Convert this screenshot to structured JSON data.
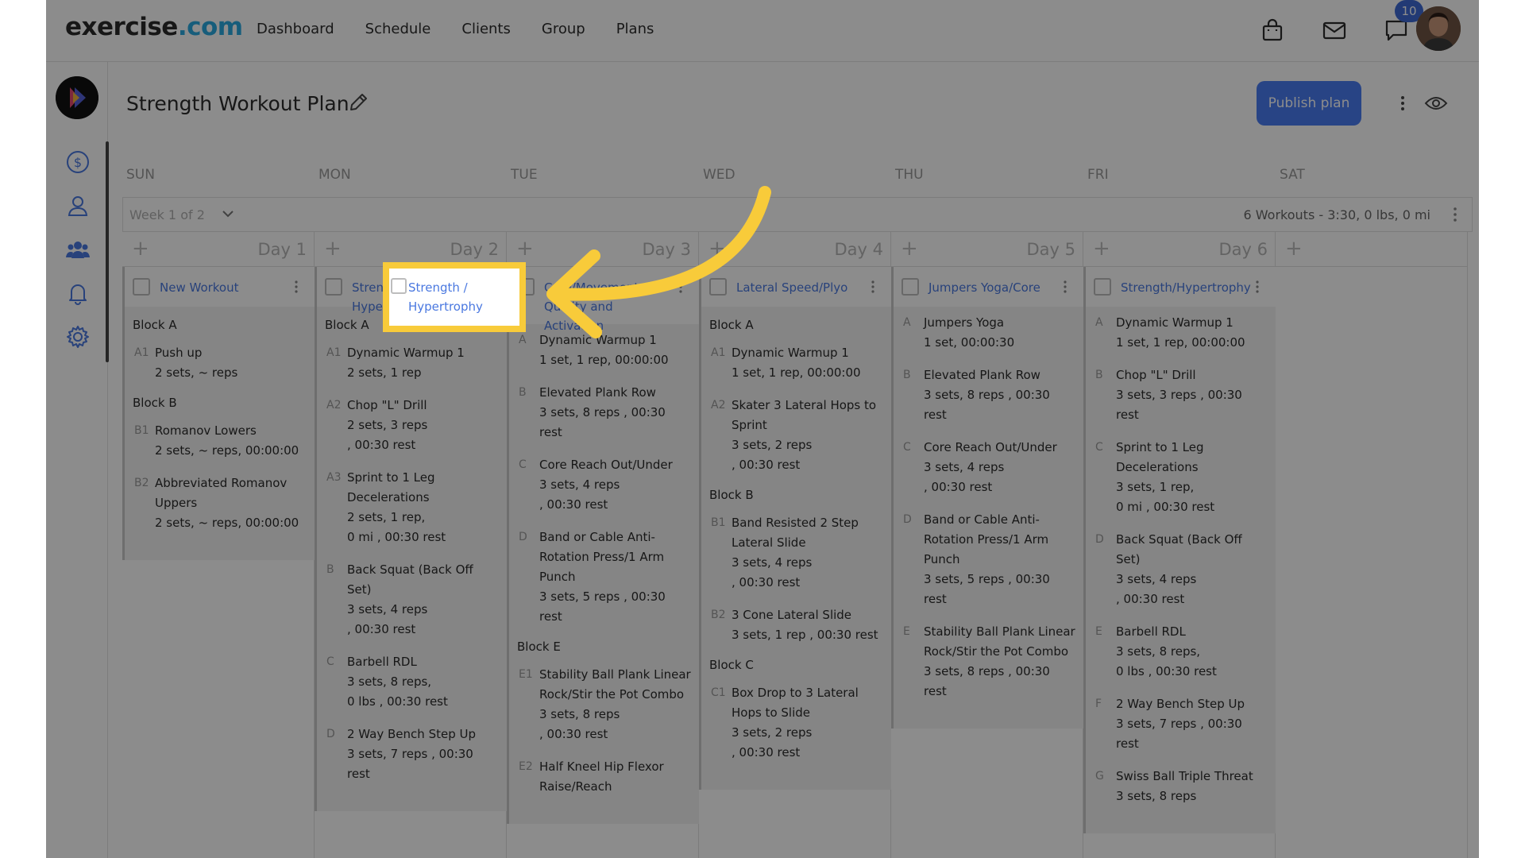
{
  "app": {
    "logo_main": "exercise",
    "logo_dot": ".com",
    "nav": [
      "Dashboard",
      "Schedule",
      "Clients",
      "Group",
      "Plans"
    ],
    "notification_count": "10",
    "icons": {
      "bag": "shopping-bag-icon",
      "mail": "mail-icon",
      "chat": "chat-icon"
    }
  },
  "sidebar": {
    "items": [
      "dollar-icon",
      "person-icon",
      "group-icon",
      "bell-icon",
      "gear-icon"
    ]
  },
  "plan": {
    "title": "Strength Workout Plan",
    "publish_label": "Publish plan"
  },
  "days_of_week": [
    "SUN",
    "MON",
    "TUE",
    "WED",
    "THU",
    "FRI",
    "SAT"
  ],
  "week": {
    "selector": "Week 1 of 2",
    "summary": "6 Workouts - 3:30, 0 lbs, 0 mi"
  },
  "columns": [
    {
      "day": "Day 1",
      "workout": "New Workout",
      "blocks": [
        {
          "label": "Block A",
          "exercises": [
            {
              "key": "A1",
              "name": "Push up",
              "details": [
                "2 sets, ~ reps"
              ]
            }
          ]
        },
        {
          "label": "Block B",
          "exercises": [
            {
              "key": "B1",
              "name": "Romanov Lowers",
              "details": [
                "2 sets, ~ reps, 00:00:00"
              ]
            },
            {
              "key": "B2",
              "name": "Abbreviated Romanov Uppers",
              "details": [
                "2 sets, ~ reps, 00:00:00"
              ]
            }
          ]
        }
      ]
    },
    {
      "day": "Day 2",
      "workout": "Strength / Hypertrophy",
      "blocks": [
        {
          "label": "Block A",
          "exercises": [
            {
              "key": "A1",
              "name": "Dynamic Warmup 1",
              "details": [
                "2 sets, 1 rep"
              ]
            },
            {
              "key": "A2",
              "name": "Chop \"L\" Drill",
              "details": [
                "2 sets, 3 reps",
                ", 00:30 rest"
              ]
            },
            {
              "key": "A3",
              "name": "Sprint to 1 Leg Decelerations",
              "details": [
                "2 sets, 1 rep,",
                "0 mi , 00:30 rest"
              ]
            }
          ]
        },
        {
          "label": "",
          "exercises": [
            {
              "key": "B",
              "name": "Back Squat (Back Off Set)",
              "details": [
                "3 sets, 4 reps",
                ", 00:30 rest"
              ]
            },
            {
              "key": "C",
              "name": "Barbell RDL",
              "details": [
                "3 sets, 8 reps,",
                "0 lbs , 00:30 rest"
              ]
            },
            {
              "key": "D",
              "name": "2 Way Bench Step Up",
              "details": [
                "3 sets, 7 reps , 00:30 rest"
              ]
            }
          ]
        }
      ]
    },
    {
      "day": "Day 3",
      "workout": "Core/Movement Quality and Activation",
      "blocks": [
        {
          "label": "",
          "exercises": [
            {
              "key": "A",
              "name": "Dynamic Warmup 1",
              "details": [
                "1 set, 1 rep, 00:00:00"
              ]
            },
            {
              "key": "B",
              "name": "Elevated Plank Row",
              "details": [
                "3 sets, 8 reps , 00:30 rest"
              ]
            },
            {
              "key": "C",
              "name": "Core Reach Out/Under",
              "details": [
                "3 sets, 4 reps",
                ", 00:30 rest"
              ]
            },
            {
              "key": "D",
              "name": "Band or Cable Anti-Rotation Press/1 Arm Punch",
              "details": [
                "3 sets, 5 reps , 00:30 rest"
              ]
            }
          ]
        },
        {
          "label": "Block E",
          "exercises": [
            {
              "key": "E1",
              "name": "Stability Ball Plank Linear Rock/Stir the Pot Combo",
              "details": [
                "3 sets, 8 reps",
                ", 00:30 rest"
              ]
            },
            {
              "key": "E2",
              "name": "Half Kneel Hip Flexor Raise/Reach",
              "details": []
            }
          ]
        }
      ]
    },
    {
      "day": "Day 4",
      "workout": "Lateral Speed/Plyo",
      "blocks": [
        {
          "label": "Block A",
          "exercises": [
            {
              "key": "A1",
              "name": "Dynamic Warmup 1",
              "details": [
                "1 set, 1 rep, 00:00:00"
              ]
            },
            {
              "key": "A2",
              "name": "Skater 3 Lateral Hops to Sprint",
              "details": [
                "3 sets, 2 reps",
                ", 00:30 rest"
              ]
            }
          ]
        },
        {
          "label": "Block B",
          "exercises": [
            {
              "key": "B1",
              "name": "Band Resisted 2 Step Lateral Slide",
              "details": [
                "3 sets, 4 reps",
                ", 00:30 rest"
              ]
            },
            {
              "key": "B2",
              "name": "3 Cone Lateral Slide",
              "details": [
                "3 sets, 1 rep , 00:30 rest"
              ]
            }
          ]
        },
        {
          "label": "Block C",
          "exercises": [
            {
              "key": "C1",
              "name": "Box Drop to 3 Lateral Hops to Slide",
              "details": [
                "3 sets, 2 reps",
                ", 00:30 rest"
              ]
            }
          ]
        }
      ]
    },
    {
      "day": "Day 5",
      "workout": "Jumpers Yoga/Core",
      "blocks": [
        {
          "label": "",
          "exercises": [
            {
              "key": "A",
              "name": "Jumpers Yoga",
              "details": [
                "1 set, 00:00:30"
              ]
            },
            {
              "key": "B",
              "name": "Elevated Plank Row",
              "details": [
                "3 sets, 8 reps , 00:30 rest"
              ]
            },
            {
              "key": "C",
              "name": "Core Reach Out/Under",
              "details": [
                "3 sets, 4 reps",
                ", 00:30 rest"
              ]
            },
            {
              "key": "D",
              "name": "Band or Cable Anti-Rotation Press/1 Arm Punch",
              "details": [
                "3 sets, 5 reps , 00:30 rest"
              ]
            },
            {
              "key": "E",
              "name": "Stability Ball Plank Linear Rock/Stir the Pot Combo",
              "details": [
                "3 sets, 8 reps , 00:30 rest"
              ]
            }
          ]
        }
      ]
    },
    {
      "day": "Day 6",
      "workout": "Strength/Hypertrophy",
      "blocks": [
        {
          "label": "",
          "exercises": [
            {
              "key": "A",
              "name": "Dynamic Warmup 1",
              "details": [
                "1 set, 1 rep, 00:00:00"
              ]
            },
            {
              "key": "B",
              "name": "Chop \"L\" Drill",
              "details": [
                "3 sets, 3 reps , 00:30 rest"
              ]
            },
            {
              "key": "C",
              "name": "Sprint to 1 Leg Decelerations",
              "details": [
                "3 sets, 1 rep,",
                "0 mi , 00:30 rest"
              ]
            },
            {
              "key": "D",
              "name": "Back Squat (Back Off Set)",
              "details": [
                "3 sets, 4 reps",
                ", 00:30 rest"
              ]
            },
            {
              "key": "E",
              "name": "Barbell RDL",
              "details": [
                "3 sets, 8 reps,",
                "0 lbs , 00:30 rest"
              ]
            },
            {
              "key": "F",
              "name": "2 Way Bench Step Up",
              "details": [
                "3 sets, 7 reps , 00:30 rest"
              ]
            },
            {
              "key": "G",
              "name": "Swiss Ball Triple Threat",
              "details": [
                "3 sets, 8 reps"
              ]
            }
          ]
        }
      ]
    },
    {
      "day": "",
      "workout": "",
      "blocks": []
    }
  ],
  "highlight": {
    "label": "Strength / Hypertrophy",
    "color": "#f8cb3a"
  }
}
